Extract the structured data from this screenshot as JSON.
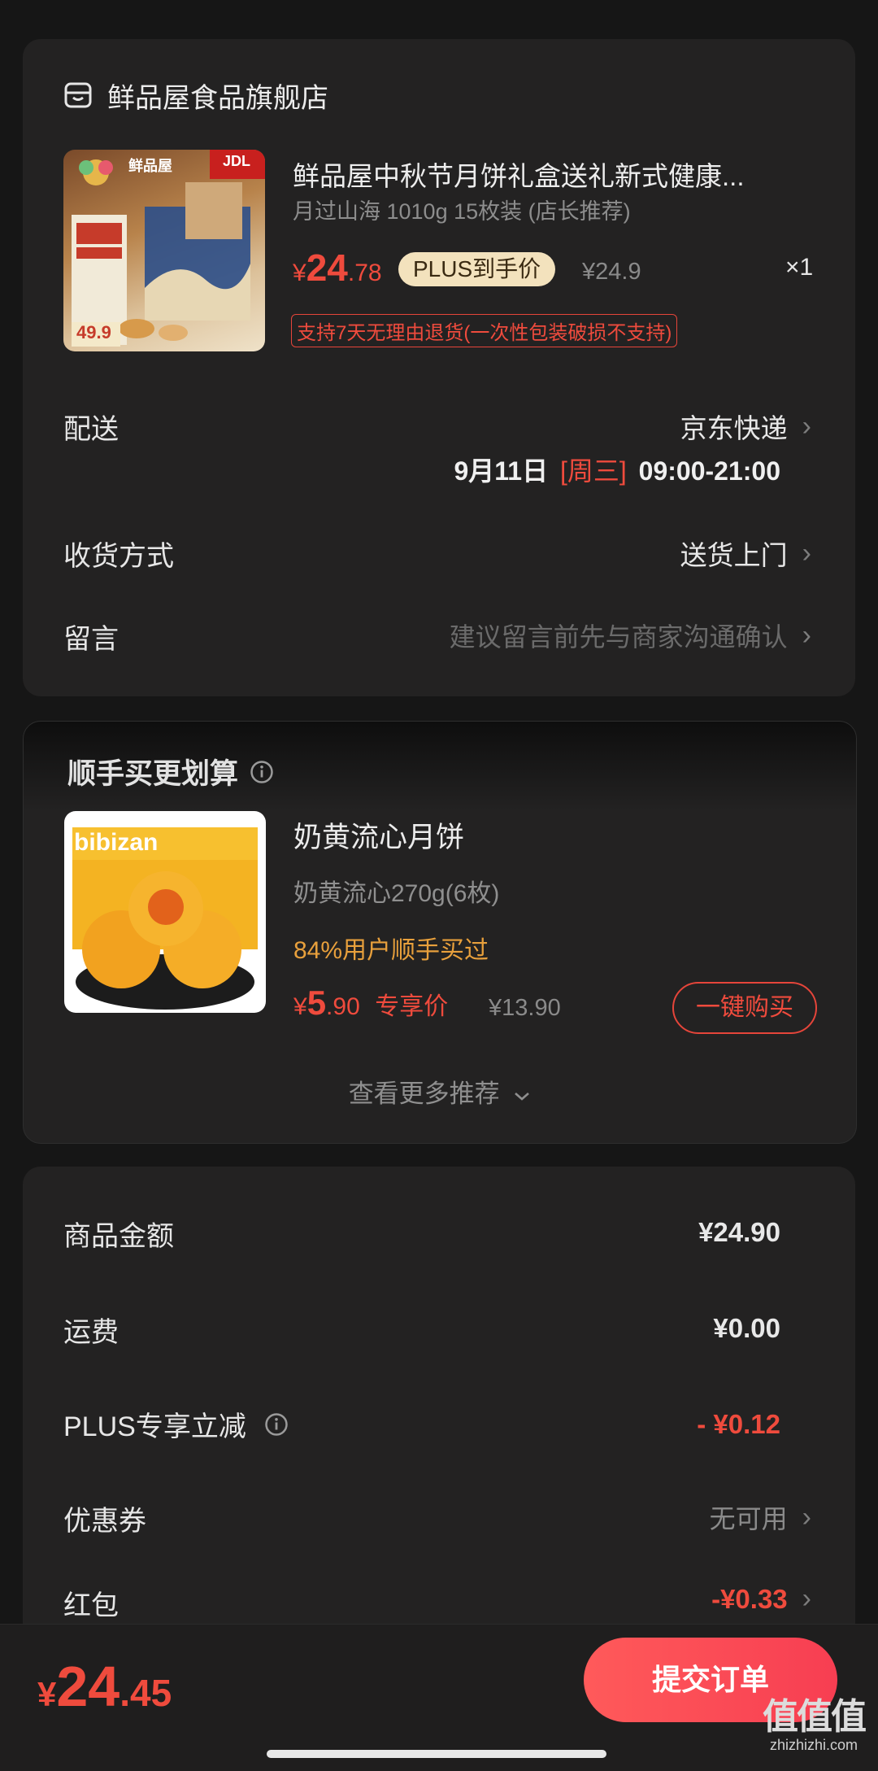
{
  "store": {
    "name": "鲜品屋食品旗舰店",
    "icon": "store-icon"
  },
  "product": {
    "title": "鲜品屋中秋节月饼礼盒送礼新式健康...",
    "spec": "月过山海 1010g 15枚装 (店长推荐)",
    "price_currency": "¥",
    "price_int": "24",
    "price_dec": ".78",
    "plus_tag": "PLUS到手价",
    "orig_price": "¥24.9",
    "qty": "×1",
    "return_policy": "支持7天无理由退货(一次性包装破损不支持)",
    "image_badges": {
      "brand": "鲜品屋",
      "jdl": "JDL",
      "price": "49.9"
    }
  },
  "delivery": {
    "label": "配送",
    "carrier": "京东快递",
    "date": "9月11日",
    "weekday": "[周三]",
    "time": "09:00-21:00"
  },
  "receive": {
    "label": "收货方式",
    "value": "送货上门"
  },
  "message": {
    "label": "留言",
    "placeholder": "建议留言前先与商家沟通确认"
  },
  "recommend": {
    "title": "顺手买更划算",
    "item": {
      "name": "奶黄流心月饼",
      "spec": "奶黄流心270g(6枚)",
      "social": "84%用户顺手买过",
      "price_currency": "¥",
      "price_int": "5",
      "price_dec": ".90",
      "price_tag": "专享价",
      "orig_price": "¥13.90",
      "buy_label": "一键购买",
      "image_text": "bibizan"
    },
    "more_label": "查看更多推荐"
  },
  "summary": {
    "rows": [
      {
        "label": "商品金额",
        "value": "¥24.90"
      },
      {
        "label": "运费",
        "value": "¥0.00"
      },
      {
        "label": "PLUS专享立减",
        "value": "- ¥0.12"
      },
      {
        "label": "优惠券",
        "value": "无可用"
      },
      {
        "label": "红包",
        "value": "-¥0.33"
      }
    ]
  },
  "footer": {
    "total_currency": "¥",
    "total_int": "24",
    "total_dec": ".45",
    "submit_label": "提交订单",
    "watermark_main": "值值值",
    "watermark_url": "zhizhizhi.com"
  },
  "colors": {
    "accent_red": "#ef4b3d",
    "plus_gold": "#f3e2bd",
    "social_orange": "#e8a03c",
    "background": "#161616",
    "card": "#232222"
  }
}
